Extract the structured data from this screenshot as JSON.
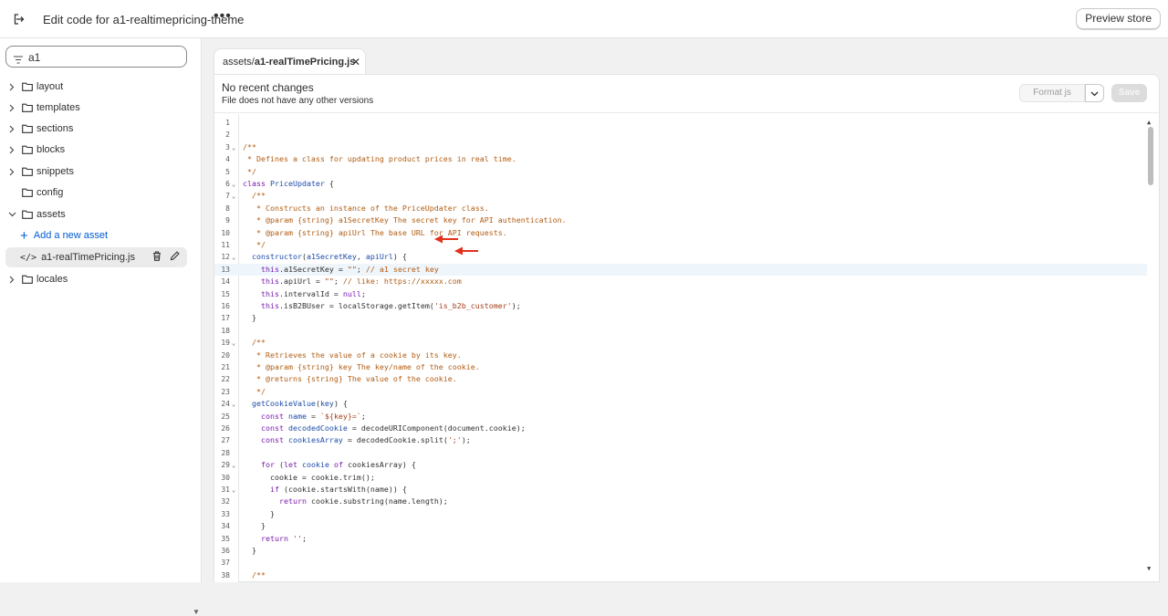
{
  "topbar": {
    "title": "Edit code for a1-realtimepricing-theme",
    "more": "•••",
    "preview_label": "Preview store"
  },
  "sidebar": {
    "search_value": "a1",
    "items": [
      {
        "label": "layout",
        "kind": "folder"
      },
      {
        "label": "templates",
        "kind": "folder"
      },
      {
        "label": "sections",
        "kind": "folder"
      },
      {
        "label": "blocks",
        "kind": "folder"
      },
      {
        "label": "snippets",
        "kind": "folder"
      },
      {
        "label": "config",
        "kind": "folder-nochev"
      },
      {
        "label": "assets",
        "kind": "folder-open"
      },
      {
        "label": "Add a new asset",
        "kind": "add"
      },
      {
        "label": "a1-realTimePricing.js",
        "kind": "file"
      },
      {
        "label": "locales",
        "kind": "folder"
      }
    ]
  },
  "tab": {
    "prefix": "assets/",
    "filename": "a1-realTimePricing.js",
    "close": "✕"
  },
  "status": {
    "heading": "No recent changes",
    "subtext": "File does not have any other versions",
    "format_label": "Format js",
    "save_label": "Save"
  },
  "editor": {
    "active_line": 13,
    "lines": [
      {
        "n": "1",
        "fold": false,
        "html": ""
      },
      {
        "n": "2",
        "fold": false,
        "html": ""
      },
      {
        "n": "3",
        "fold": true,
        "html": "<span class=\"cm\">/**</span>"
      },
      {
        "n": "4",
        "fold": false,
        "html": "<span class=\"cm\"> * Defines a class for updating product prices in real time.</span>"
      },
      {
        "n": "5",
        "fold": false,
        "html": "<span class=\"cm\"> */</span>"
      },
      {
        "n": "6",
        "fold": true,
        "html": "<span class=\"kw\">class</span> <span class=\"nm\">PriceUpdater</span> {"
      },
      {
        "n": "7",
        "fold": true,
        "html": "  <span class=\"cm\">/**</span>"
      },
      {
        "n": "8",
        "fold": false,
        "html": "<span class=\"cm\">   * Constructs an instance of the PriceUpdater class.</span>"
      },
      {
        "n": "9",
        "fold": false,
        "html": "<span class=\"cm\">   * @param {string} a1SecretKey The secret key for API authentication.</span>"
      },
      {
        "n": "10",
        "fold": false,
        "html": "<span class=\"cm\">   * @param {string} apiUrl The base URL for API requests.</span>"
      },
      {
        "n": "11",
        "fold": false,
        "html": "<span class=\"cm\">   */</span>"
      },
      {
        "n": "12",
        "fold": true,
        "html": "  <span class=\"nm\">constructor</span>(<span class=\"nm\">a1SecretKey</span>, <span class=\"nm\">apiUrl</span>) {"
      },
      {
        "n": "13",
        "fold": false,
        "html": "    <span class=\"kw\">this</span>.a1SecretKey = <span class=\"str\">\"\"</span>; <span class=\"cm\">// a1 secret key</span>"
      },
      {
        "n": "14",
        "fold": false,
        "html": "    <span class=\"kw\">this</span>.apiUrl = <span class=\"str\">\"\"</span>; <span class=\"cm\">// like: https://xxxxx.com</span>"
      },
      {
        "n": "15",
        "fold": false,
        "html": "    <span class=\"kw\">this</span>.intervalId = <span class=\"kw\">null</span>;"
      },
      {
        "n": "16",
        "fold": false,
        "html": "    <span class=\"kw\">this</span>.isB2BUser = localStorage.getItem(<span class=\"str\">'is_b2b_customer'</span>);"
      },
      {
        "n": "17",
        "fold": false,
        "html": "  }"
      },
      {
        "n": "18",
        "fold": false,
        "html": ""
      },
      {
        "n": "19",
        "fold": true,
        "html": "  <span class=\"cm\">/**</span>"
      },
      {
        "n": "20",
        "fold": false,
        "html": "<span class=\"cm\">   * Retrieves the value of a cookie by its key.</span>"
      },
      {
        "n": "21",
        "fold": false,
        "html": "<span class=\"cm\">   * @param {string} key The key/name of the cookie.</span>"
      },
      {
        "n": "22",
        "fold": false,
        "html": "<span class=\"cm\">   * @returns {string} The value of the cookie.</span>"
      },
      {
        "n": "23",
        "fold": false,
        "html": "<span class=\"cm\">   */</span>"
      },
      {
        "n": "24",
        "fold": true,
        "html": "  <span class=\"nm\">getCookieValue</span>(<span class=\"nm\">key</span>) {"
      },
      {
        "n": "25",
        "fold": false,
        "html": "    <span class=\"kw\">const</span> <span class=\"nm\">name</span> = <span class=\"str\">`${key}=`</span>;"
      },
      {
        "n": "26",
        "fold": false,
        "html": "    <span class=\"kw\">const</span> <span class=\"nm\">decodedCookie</span> = decodeURIComponent(document.cookie);"
      },
      {
        "n": "27",
        "fold": false,
        "html": "    <span class=\"kw\">const</span> <span class=\"nm\">cookiesArray</span> = decodedCookie.split(<span class=\"str\">';'</span>);"
      },
      {
        "n": "28",
        "fold": false,
        "html": ""
      },
      {
        "n": "29",
        "fold": true,
        "html": "    <span class=\"kw\">for</span> (<span class=\"kw\">let</span> <span class=\"nm\">cookie</span> <span class=\"kw\">of</span> cookiesArray) {"
      },
      {
        "n": "30",
        "fold": false,
        "html": "      cookie = cookie.trim();"
      },
      {
        "n": "31",
        "fold": true,
        "html": "      <span class=\"kw\">if</span> (cookie.startsWith(name)) {"
      },
      {
        "n": "32",
        "fold": false,
        "html": "        <span class=\"kw\">return</span> cookie.substring(name.length);"
      },
      {
        "n": "33",
        "fold": false,
        "html": "      }"
      },
      {
        "n": "34",
        "fold": false,
        "html": "    }"
      },
      {
        "n": "35",
        "fold": false,
        "html": "    <span class=\"kw\">return</span> <span class=\"str\">''</span>;"
      },
      {
        "n": "36",
        "fold": false,
        "html": "  }"
      },
      {
        "n": "37",
        "fold": false,
        "html": ""
      },
      {
        "n": "38",
        "fold": false,
        "html": "  <span class=\"cm\">/**</span>"
      }
    ]
  },
  "colors": {
    "accent_link": "#005bd3",
    "annotation_arrow": "#e3301b"
  }
}
